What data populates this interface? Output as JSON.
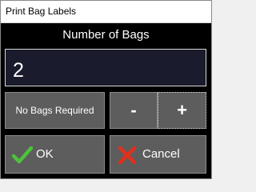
{
  "window": {
    "title": "Print Bag Labels"
  },
  "heading": "Number of Bags",
  "bag_count": {
    "value": "2"
  },
  "buttons": {
    "no_bags": "No Bags Required",
    "decrement": "-",
    "increment": "+",
    "ok": "OK",
    "cancel": "Cancel"
  },
  "icons": {
    "ok": "check-icon",
    "cancel": "x-icon"
  },
  "colors": {
    "background": "#000000",
    "button": "#5d5d5d",
    "input_background": "#1a1b2c",
    "check": "#4cc23a",
    "cross": "#e0301e"
  }
}
